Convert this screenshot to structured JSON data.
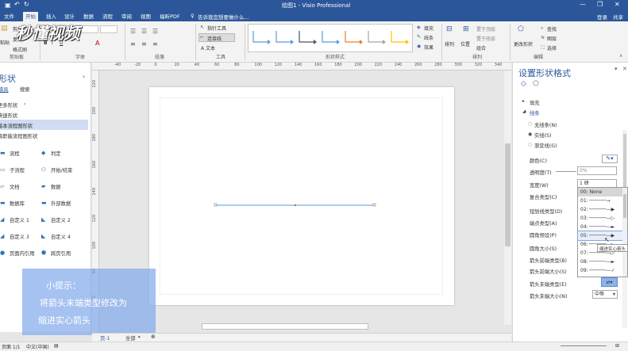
{
  "window": {
    "title": "绘图1 - Visio Professional",
    "login": "登录",
    "share": "共享"
  },
  "tabs": [
    "文件",
    "开始",
    "插入",
    "设计",
    "数据",
    "流程",
    "审阅",
    "视图",
    "福昕PDF"
  ],
  "tell_me": "告诉我您想要做什么...",
  "ribbon": {
    "clipboard": {
      "paste": "粘贴",
      "cut": "剪切",
      "copy": "复制",
      "format_painter": "格式刷",
      "label": "剪贴板"
    },
    "font": {
      "bold": "B",
      "italic": "I",
      "underline": "U",
      "label": "字体"
    },
    "paragraph": {
      "label": "段落"
    },
    "tools": {
      "pointer": "指针工具",
      "connector": "连接线",
      "text": "A 文本",
      "label": "工具"
    },
    "shape_styles": {
      "label": "形状样式",
      "swatch_colors": [
        "#5b9bd5",
        "#5b9bd5",
        "#44546a",
        "#5b9bd5",
        "#ed7d31",
        "#a5a5a5",
        "#ffc000"
      ]
    },
    "fill": "填充",
    "line": "线条",
    "effects": "效果",
    "arrange": {
      "align": "排列",
      "position": "位置",
      "bring_front": "置于顶层",
      "send_back": "置于底层",
      "group": "组合",
      "label": "排列"
    },
    "change_shape": "更改形状",
    "editing": {
      "find": "查找",
      "layer": "图层",
      "select": "选择",
      "label": "编辑"
    }
  },
  "left_pane": {
    "title": "形状",
    "tab_stencils": "模具",
    "tab_search": "搜索",
    "links": [
      "更多形状",
      "快速形状",
      "基本流程图形状",
      "跨职能流程图形状"
    ],
    "shapes": [
      [
        "流程",
        "判定"
      ],
      [
        "子流程",
        "开始/结束"
      ],
      [
        "文档",
        "数据"
      ],
      [
        "数据库",
        "外部数据"
      ],
      [
        "自定义 1",
        "自定义 2"
      ],
      [
        "自定义 3",
        "自定义 4"
      ],
      [
        "页面内引用",
        "跨页引用"
      ]
    ]
  },
  "rulers": {
    "h": [
      "-40",
      "-20",
      "0",
      "20",
      "40",
      "60",
      "80",
      "100",
      "120",
      "140",
      "160",
      "180",
      "200",
      "220",
      "240",
      "260",
      "280",
      "300",
      "320",
      "340"
    ],
    "v": [
      "220",
      "200",
      "180",
      "160",
      "140",
      "120",
      "100",
      "80",
      "60"
    ]
  },
  "right_pane": {
    "title": "设置形状格式",
    "fill": "填充",
    "line": "线条",
    "no_line": "无线条(N)",
    "solid_line": "实线(S)",
    "gradient_line": "渐变线(G)",
    "color": "颜色(C)",
    "transparency": "透明度(T)",
    "transparency_value": "0%",
    "width": "宽度(W)",
    "width_value": "1 磅",
    "compound": "复合类型(C)",
    "dash": "短划线类型(D)",
    "cap": "端点类型(A)",
    "round_preset": "圆角预设(P)",
    "round_size": "圆角大小(S)",
    "begin_type": "箭头前端类型(B)",
    "begin_size": "箭头前端大小(S)",
    "end_type": "箭头末端类型(E)",
    "end_size": "箭头末端大小(N)",
    "end_size_value": "中等"
  },
  "arrow_list": {
    "items": [
      "00: None",
      "01:",
      "02:",
      "03:",
      "04:",
      "05:",
      "06:",
      "07:",
      "08:",
      "09:"
    ],
    "tooltip": "缩进实心箭头"
  },
  "status": {
    "page": "页面 1/1",
    "lang": "中文(中国)",
    "page_tab": "页-1",
    "all": "全部"
  },
  "hint": {
    "title": "小提示：",
    "line1": "将箭头末端类型修改为",
    "line2": "缩进实心箭头"
  },
  "watermark": "秒懂视频"
}
